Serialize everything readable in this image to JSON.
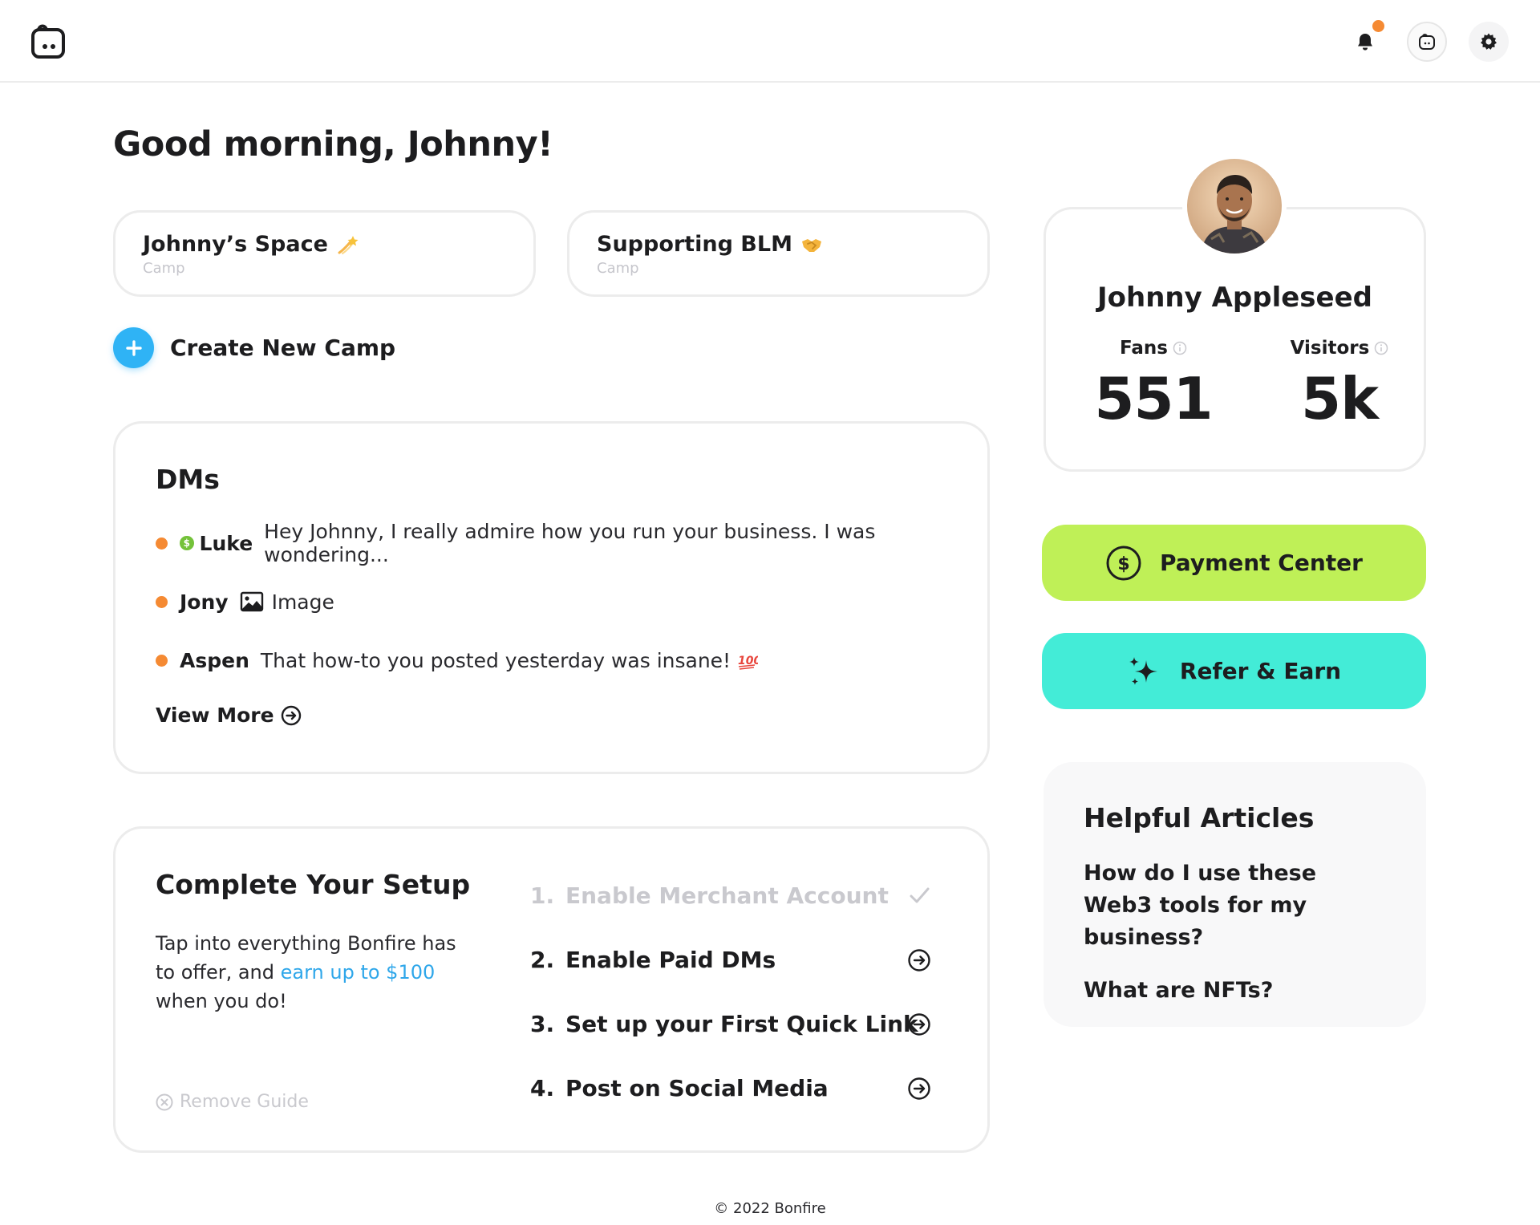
{
  "header": {
    "logo_icon": "bonfire-logo-icon",
    "notification_icon": "bell-icon",
    "profile_icon": "avatar-face-icon",
    "settings_icon": "gear-icon",
    "notification_dot_color": "#f58a33"
  },
  "greeting": "Good morning, Johnny!",
  "camps": [
    {
      "title": "Johnny’s Space",
      "subtitle": "Camp",
      "icon": "shooting-star-icon"
    },
    {
      "title": "Supporting BLM",
      "subtitle": "Camp",
      "icon": "handshake-icon"
    }
  ],
  "create_camp": {
    "label": "Create New Camp",
    "icon": "plus-icon",
    "color": "#2fb3f5"
  },
  "dms": {
    "heading": "DMs",
    "items": [
      {
        "name": "Luke",
        "message": "Hey Johnny, I really admire how you run your business. I was wondering...",
        "paid": true
      },
      {
        "name": "Jony",
        "message": "Image",
        "attachment_icon": "image-icon"
      },
      {
        "name": "Aspen",
        "message": "That how-to you posted yesterday was insane!",
        "emoji_icon": "hundred-points-icon"
      }
    ],
    "view_more": "View More"
  },
  "setup": {
    "heading": "Complete Your Setup",
    "desc_before": "Tap into everything Bonfire has to offer, and ",
    "desc_link": "earn up to $100",
    "desc_after": " when you do!",
    "remove_guide": "Remove Guide",
    "steps": [
      {
        "num": "1.",
        "label": "Enable Merchant Account",
        "done": true
      },
      {
        "num": "2.",
        "label": "Enable Paid DMs",
        "done": false
      },
      {
        "num": "3.",
        "label": "Set up your First Quick Link",
        "done": false
      },
      {
        "num": "4.",
        "label": "Post on Social Media",
        "done": false
      }
    ]
  },
  "profile": {
    "name": "Johnny Appleseed",
    "fans_label": "Fans",
    "fans_value": "551",
    "visitors_label": "Visitors",
    "visitors_value": "5k"
  },
  "actions": {
    "payment_label": "Payment Center",
    "payment_color": "#bff057",
    "refer_label": "Refer & Earn",
    "refer_color": "#43ecd7"
  },
  "articles": {
    "heading": "Helpful Articles",
    "items": [
      "How do I use these Web3 tools for my business?",
      "What are NFTs?"
    ]
  },
  "footer": "© 2022 Bonfire"
}
